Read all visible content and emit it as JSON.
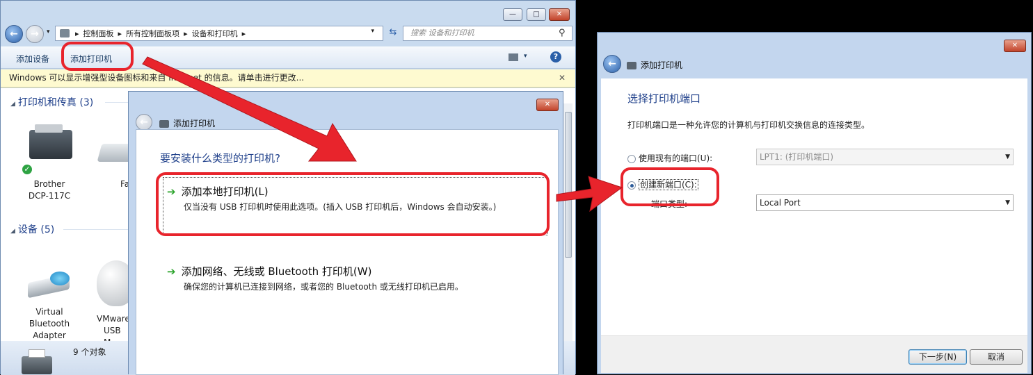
{
  "explorer": {
    "breadcrumb": [
      "控制面板",
      "所有控制面板项",
      "设备和打印机"
    ],
    "search_placeholder": "搜索 设备和打印机",
    "commands": {
      "add_device": "添加设备",
      "add_printer": "添加打印机"
    },
    "infobar": "Windows 可以显示增强型设备图标和来自 Internet 的信息。请单击进行更改...",
    "groups": {
      "printers": "打印机和传真 (3)",
      "devices": "设备 (5)"
    },
    "printers": [
      {
        "label_line1": "Brother",
        "label_line2": "DCP-117C"
      },
      {
        "label_line1": "Fa",
        "label_line2": ""
      }
    ],
    "devices": [
      {
        "label_line1": "Virtual",
        "label_line2": "Bluetooth",
        "label_line3": "Adapter"
      },
      {
        "label_line1": "VMware",
        "label_line2": "USB M",
        "label_line3": ""
      }
    ],
    "status": "9 个对象"
  },
  "dialog1": {
    "title": "添加打印机",
    "heading": "要安装什么类型的打印机?",
    "option_local": {
      "title": "添加本地打印机(L)",
      "desc": "仅当没有 USB 打印机时使用此选项。(插入 USB 打印机后，Windows 会自动安装。)"
    },
    "option_network": {
      "title": "添加网络、无线或 Bluetooth 打印机(W)",
      "desc": "确保您的计算机已连接到网络，或者您的 Bluetooth 或无线打印机已启用。"
    }
  },
  "dialog2": {
    "title": "添加打印机",
    "heading": "选择打印机端口",
    "desc": "打印机端口是一种允许您的计算机与打印机交换信息的连接类型。",
    "use_existing_label": "使用现有的端口(U):",
    "existing_port_value": "LPT1: (打印机端口)",
    "create_new_label": "创建新端口(C):",
    "port_type_label": "端口类型:",
    "port_type_value": "Local Port",
    "next_button": "下一步(N)",
    "cancel_button": "取消"
  },
  "icons": [
    "back-arrow-icon",
    "forward-arrow-icon",
    "printer-icon",
    "search-icon",
    "refresh-icon",
    "help-icon",
    "close-icon",
    "green-arrow-icon"
  ],
  "colors": {
    "annotation_red": "#e8242c",
    "heading_blue": "#1e3f8a",
    "window_frame": "#c3d6ee"
  }
}
